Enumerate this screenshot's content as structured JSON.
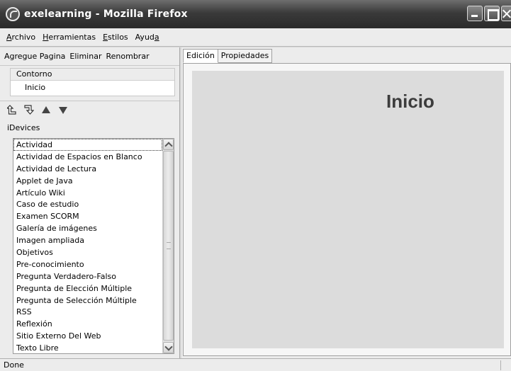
{
  "window": {
    "title": "exelearning - Mozilla Firefox"
  },
  "menu": [
    {
      "mnemonic": "A",
      "rest": "rchivo"
    },
    {
      "mnemonic": "H",
      "rest": "erramientas"
    },
    {
      "mnemonic": "E",
      "rest": "stilos"
    },
    {
      "prefix": "Ayud",
      "mnemonic": "a"
    }
  ],
  "left_toolbar": {
    "add": "Agregue Pagina",
    "delete": "Eliminar",
    "rename": "Renombrar"
  },
  "outline": {
    "header": "Contorno",
    "nodes": [
      "Inicio"
    ]
  },
  "idevices": {
    "label": "iDevices",
    "items": [
      "Actividad",
      "Actividad de Espacios en Blanco",
      "Actividad de Lectura",
      "Applet de Java",
      "Artículo Wiki",
      "Caso de estudio",
      "Examen SCORM",
      "Galería de imágenes",
      "Imagen ampliada",
      "Objetivos",
      "Pre-conocimiento",
      "Pregunta Verdadero-Falso",
      "Pregunta de Elección Múltiple",
      "Pregunta de Selección Múltiple",
      "RSS",
      "Reflexión",
      "Sitio Externo Del Web",
      "Texto Libre"
    ]
  },
  "tabs": [
    "Edición",
    "Propiedades"
  ],
  "content": {
    "heading": "Inicio"
  },
  "status": {
    "text": "Done"
  }
}
